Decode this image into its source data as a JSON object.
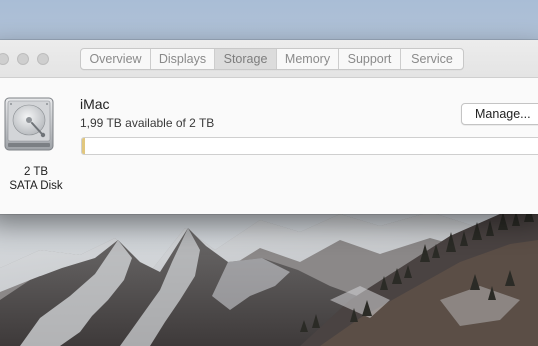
{
  "window": {
    "tabs": [
      {
        "label": "Overview",
        "selected": false
      },
      {
        "label": "Displays",
        "selected": false
      },
      {
        "label": "Storage",
        "selected": true
      },
      {
        "label": "Memory",
        "selected": false
      },
      {
        "label": "Support",
        "selected": false
      },
      {
        "label": "Service",
        "selected": false
      }
    ]
  },
  "storage": {
    "disk_icon": "hard-drive-icon",
    "disk_size_label": "2 TB",
    "disk_type_label": "SATA Disk",
    "drive_name": "iMac",
    "availability_text": "1,99 TB available of 2 TB",
    "manage_label": "Manage...",
    "used_fraction": 0.005,
    "used_color": "#e1c77e"
  }
}
